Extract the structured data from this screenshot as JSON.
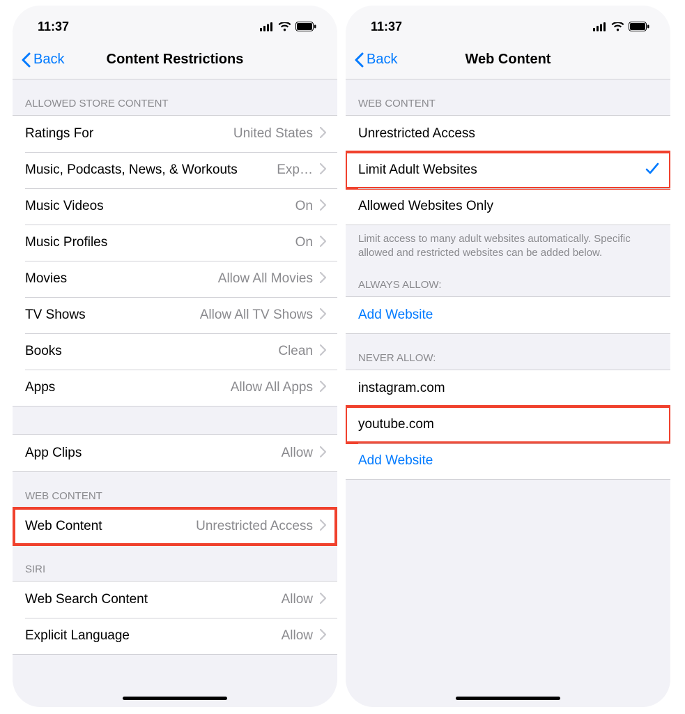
{
  "status": {
    "time": "11:37"
  },
  "left": {
    "back": "Back",
    "title": "Content Restrictions",
    "sections": {
      "store_header": "ALLOWED STORE CONTENT",
      "web_header": "WEB CONTENT",
      "siri_header": "SIRI"
    },
    "rows": {
      "ratings": {
        "label": "Ratings For",
        "value": "United States"
      },
      "music": {
        "label": "Music, Podcasts, News, & Workouts",
        "value": "Exp…"
      },
      "music_videos": {
        "label": "Music Videos",
        "value": "On"
      },
      "music_profiles": {
        "label": "Music Profiles",
        "value": "On"
      },
      "movies": {
        "label": "Movies",
        "value": "Allow All Movies"
      },
      "tv": {
        "label": "TV Shows",
        "value": "Allow All TV Shows"
      },
      "books": {
        "label": "Books",
        "value": "Clean"
      },
      "apps": {
        "label": "Apps",
        "value": "Allow All Apps"
      },
      "app_clips": {
        "label": "App Clips",
        "value": "Allow"
      },
      "web_content": {
        "label": "Web Content",
        "value": "Unrestricted Access"
      },
      "web_search": {
        "label": "Web Search Content",
        "value": "Allow"
      },
      "explicit_lang": {
        "label": "Explicit Language",
        "value": "Allow"
      }
    }
  },
  "right": {
    "back": "Back",
    "title": "Web Content",
    "sections": {
      "web_header": "WEB CONTENT",
      "always_header": "ALWAYS ALLOW:",
      "never_header": "NEVER ALLOW:"
    },
    "footer": "Limit access to many adult websites automatically. Specific allowed and restricted websites can be added below.",
    "options": {
      "unrestricted": "Unrestricted Access",
      "limit_adult": "Limit Adult Websites",
      "allowed_only": "Allowed Websites Only"
    },
    "always": {
      "add": "Add Website"
    },
    "never": {
      "items": [
        "instagram.com",
        "youtube.com"
      ],
      "add": "Add Website"
    }
  }
}
